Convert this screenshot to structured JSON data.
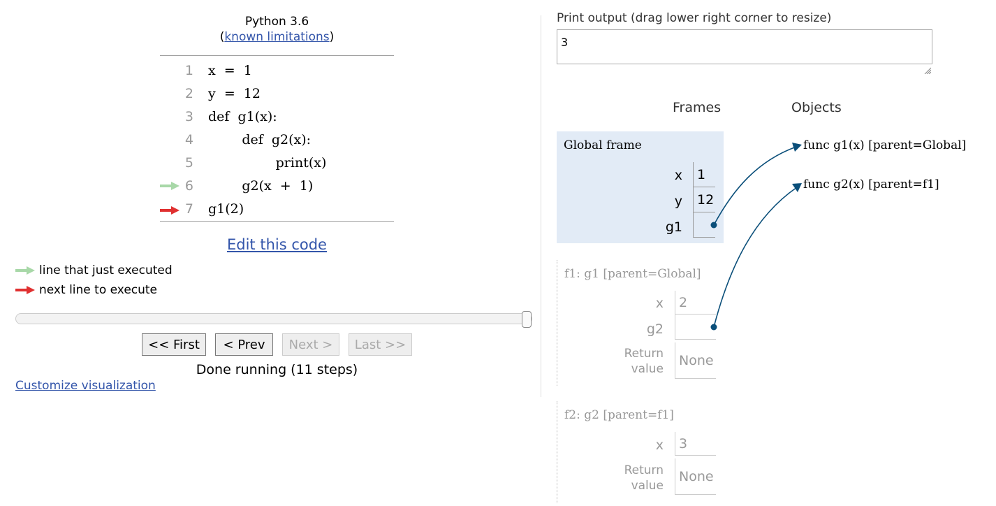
{
  "header": {
    "language": "Python 3.6",
    "limits_open": "(",
    "limits_link": "known limitations",
    "limits_close": ")"
  },
  "code": [
    {
      "num": "1",
      "text": "x  =  1",
      "arrow": ""
    },
    {
      "num": "2",
      "text": "y  =  12",
      "arrow": ""
    },
    {
      "num": "3",
      "text": "def  g1(x):",
      "arrow": ""
    },
    {
      "num": "4",
      "text": "        def  g2(x):",
      "arrow": ""
    },
    {
      "num": "5",
      "text": "                print(x)",
      "arrow": ""
    },
    {
      "num": "6",
      "text": "        g2(x  +  1)",
      "arrow": "green"
    },
    {
      "num": "7",
      "text": "g1(2)",
      "arrow": "red"
    }
  ],
  "edit_link": "Edit this code",
  "legend": {
    "green_label": "line that just executed",
    "red_label": "next line to execute",
    "green_color": "#a8d8a8",
    "red_color": "#e03030"
  },
  "slider": {
    "position": 1.0
  },
  "nav": {
    "first": "<< First",
    "prev": "< Prev",
    "next": "Next >",
    "last": "Last >>"
  },
  "status": "Done running (11 steps)",
  "customize_link": "Customize visualization",
  "print_output": {
    "label": "Print output (drag lower right corner to resize)",
    "value": "3"
  },
  "headers": {
    "frames": "Frames",
    "objects": "Objects"
  },
  "global_frame": {
    "title": "Global frame",
    "vars": [
      {
        "name": "x",
        "value": "1"
      },
      {
        "name": "y",
        "value": "12"
      },
      {
        "name": "g1",
        "value": ""
      }
    ],
    "bg_color": "#e2ebf6"
  },
  "f1": {
    "title": "f1: g1 [parent=Global]",
    "vars": [
      {
        "name": "x",
        "value": "2"
      },
      {
        "name": "g2",
        "value": ""
      }
    ],
    "return_label_1": "Return",
    "return_label_2": "value",
    "return_value": "None"
  },
  "f2": {
    "title": "f2: g2 [parent=f1]",
    "vars": [
      {
        "name": "x",
        "value": "3"
      }
    ],
    "return_label_1": "Return",
    "return_label_2": "value",
    "return_value": "None"
  },
  "objects": [
    {
      "label": "func g1(x) [parent=Global]"
    },
    {
      "label": "func g2(x) [parent=f1]"
    }
  ],
  "pointer_color": "#0b4f7a"
}
